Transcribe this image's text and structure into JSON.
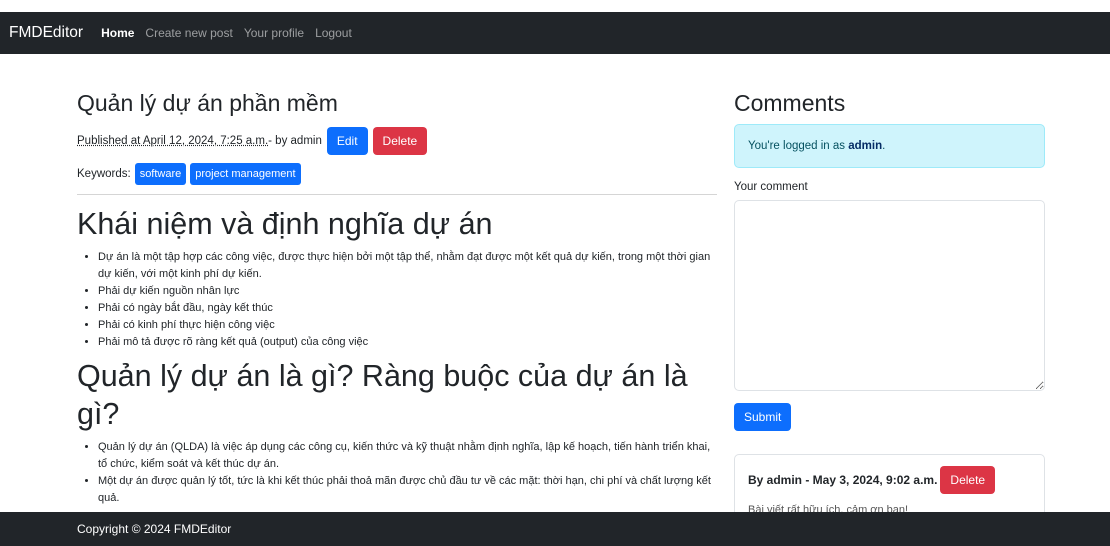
{
  "nav": {
    "brand": "FMDEditor",
    "links": [
      "Home",
      "Create new post",
      "Your profile",
      "Logout"
    ]
  },
  "post": {
    "title": "Quản lý dự án phần mềm",
    "published": "Published at April 12, 2024, 7:25 a.m.",
    "by": " - by admin",
    "edit_label": "Edit",
    "delete_label": "Delete",
    "keywords_label": "Keywords:",
    "keywords": [
      "software",
      "project management"
    ],
    "section1_title": "Khái niệm và định nghĩa dự án",
    "section1_items": [
      "Dự án là một tập hợp các công việc, được thực hiện bởi một tập thể, nhằm đạt được một kết quả dự kiến, trong một thời gian dự kiến, với một kinh phí dự kiến.",
      "Phải dự kiến nguồn nhân lực",
      "Phải có ngày bắt đầu, ngày kết thúc",
      "Phải có kinh phí thực hiện công việc",
      "Phải mô tả được rõ ràng kết quả (output) của công việc"
    ],
    "section2_title": "Quản lý dự án là gì? Ràng buộc của dự án là gì?",
    "section2_items": [
      "Quản lý dự án (QLDA) là việc áp dụng các công cụ, kiến thức và kỹ thuật nhằm định nghĩa, lập kế hoạch, tiến hành triển khai, tổ chức, kiểm soát và kết thúc dự án.",
      "Một dự án được quản lý tốt, tức là khi kết thúc phải thoả mãn được chủ đầu tư về các mặt: thời hạn, chi phí và chất lượng kết quả."
    ]
  },
  "comments": {
    "title": "Comments",
    "logged_prefix": "You're logged in as ",
    "logged_user": "admin",
    "logged_suffix": ".",
    "your_comment_label": "Your comment",
    "submit_label": "Submit",
    "items": [
      {
        "header": "By admin - May 3, 2024, 9:02 a.m.",
        "delete_label": "Delete",
        "body": "Bài viết rất hữu ích, cảm ơn bạn!"
      }
    ]
  },
  "footer": {
    "text": "Copyright © 2024 FMDEditor"
  }
}
